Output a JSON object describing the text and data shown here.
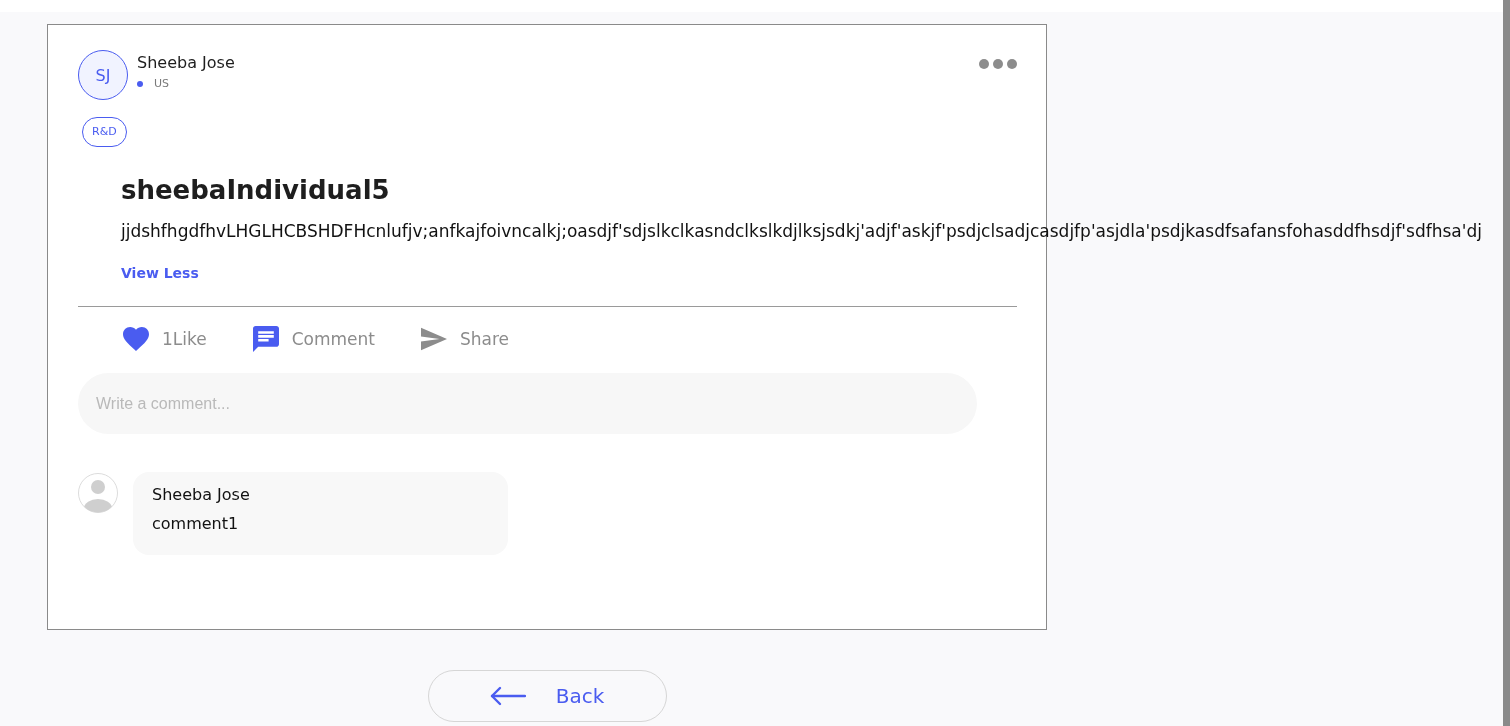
{
  "post": {
    "author": {
      "initials": "SJ",
      "name": "Sheeba Jose",
      "location": "US"
    },
    "tag": "R&D",
    "title": "sheebaIndividual5",
    "body": "jjdshfhgdfhvLHGLHCBSHDFHcnlufjv;anfkajfoivncalkj;oasdjf'sdjslkclkasndclkslkdjlksjsdkj'adjf'askjf'psdjclsadjcasdjfp'asjdla'psdjkasdfsafansfohasddfhsdjf'sdfhsa'dj",
    "toggle_link": "View Less"
  },
  "actions": [
    {
      "kind": "like",
      "label": "1Like",
      "active": true
    },
    {
      "kind": "comment",
      "label": "Comment",
      "active": true
    },
    {
      "kind": "share",
      "label": "Share",
      "active": false
    }
  ],
  "comment_box": {
    "placeholder": "Write a comment..."
  },
  "comments": [
    {
      "author": "Sheeba Jose",
      "text": "comment1"
    }
  ],
  "back_button": {
    "label": "Back"
  }
}
